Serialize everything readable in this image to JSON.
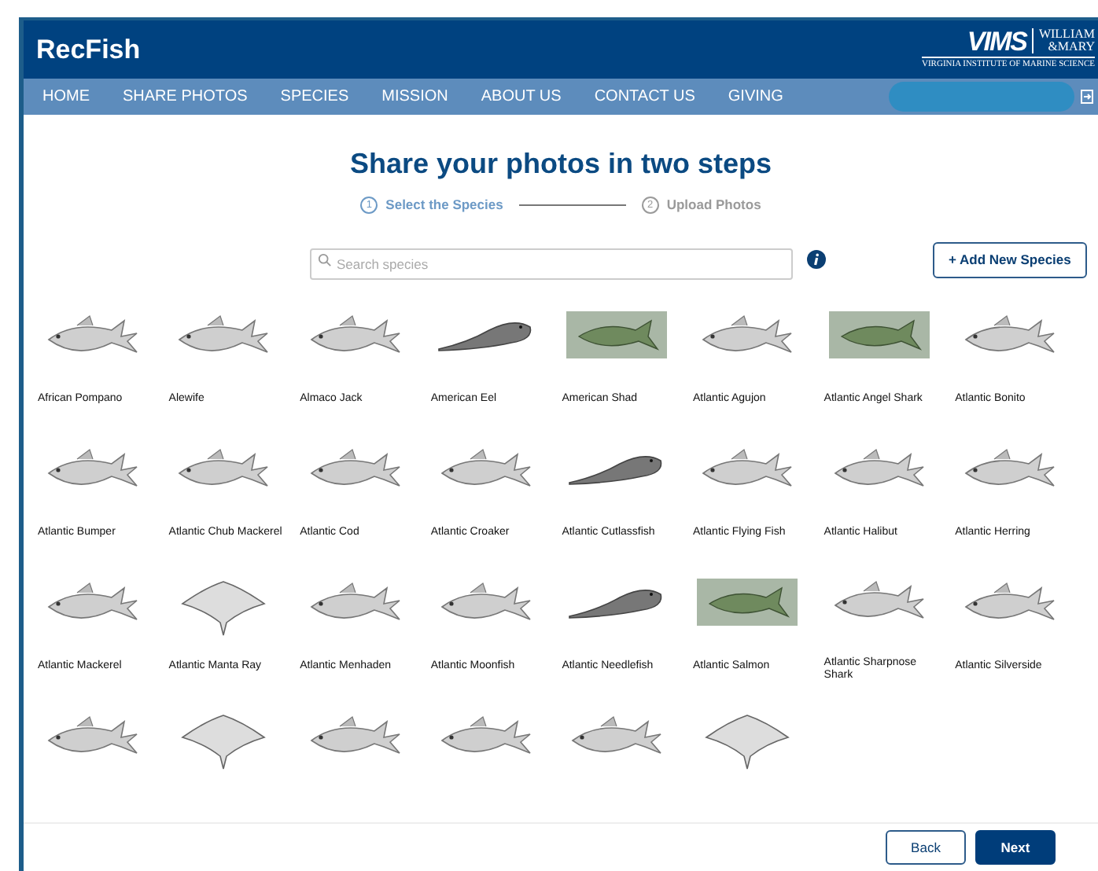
{
  "header": {
    "site_title": "RecFish",
    "logo": {
      "mark": "VIMS",
      "school_line_1": "WILLIAM",
      "school_line_2": "&MARY",
      "institute": "VIRGINIA INSTITUTE OF MARINE SCIENCE"
    }
  },
  "nav": {
    "items": [
      "HOME",
      "SHARE PHOTOS",
      "SPECIES",
      "MISSION",
      "ABOUT US",
      "CONTACT US",
      "GIVING"
    ],
    "search_field": true
  },
  "heading": "Share your photos in two steps",
  "steps": [
    {
      "number": "1",
      "label": "Select the Species",
      "selected": true
    },
    {
      "number": "2",
      "label": "Upload Photos",
      "selected": false
    }
  ],
  "search": {
    "placeholder": "Search species"
  },
  "add_button": "+ Add New Species",
  "species": [
    {
      "name": "African Pompano",
      "kind": "drawing"
    },
    {
      "name": "Alewife",
      "kind": "drawing"
    },
    {
      "name": "Almaco Jack",
      "kind": "drawing"
    },
    {
      "name": "American Eel",
      "kind": "eel"
    },
    {
      "name": "American Shad",
      "kind": "photo"
    },
    {
      "name": "Atlantic Agujon",
      "kind": "drawing"
    },
    {
      "name": "Atlantic Angel Shark",
      "kind": "photo"
    },
    {
      "name": "Atlantic Bonito",
      "kind": "drawing"
    },
    {
      "name": "Atlantic Bumper",
      "kind": "drawing"
    },
    {
      "name": "Atlantic Chub Mackerel",
      "kind": "drawing"
    },
    {
      "name": "Atlantic Cod",
      "kind": "drawing"
    },
    {
      "name": "Atlantic Croaker",
      "kind": "drawing"
    },
    {
      "name": "Atlantic Cutlassfish",
      "kind": "eel"
    },
    {
      "name": "Atlantic Flying Fish",
      "kind": "drawing"
    },
    {
      "name": "Atlantic Halibut",
      "kind": "drawing"
    },
    {
      "name": "Atlantic Herring",
      "kind": "drawing"
    },
    {
      "name": "Atlantic Mackerel",
      "kind": "drawing"
    },
    {
      "name": "Atlantic Manta Ray",
      "kind": "ray"
    },
    {
      "name": "Atlantic Menhaden",
      "kind": "drawing"
    },
    {
      "name": "Atlantic Moonfish",
      "kind": "drawing"
    },
    {
      "name": "Atlantic Needlefish",
      "kind": "eel"
    },
    {
      "name": "Atlantic Salmon",
      "kind": "photo"
    },
    {
      "name": "Atlantic Sharpnose Shark",
      "kind": "drawing"
    },
    {
      "name": "Atlantic Silverside",
      "kind": "drawing"
    },
    {
      "kind": "drawing"
    },
    {
      "kind": "ray"
    },
    {
      "kind": "drawing"
    },
    {
      "kind": "drawing"
    },
    {
      "kind": "drawing"
    },
    {
      "kind": "ray"
    }
  ],
  "footer": {
    "back": "Back",
    "next": "Next"
  }
}
